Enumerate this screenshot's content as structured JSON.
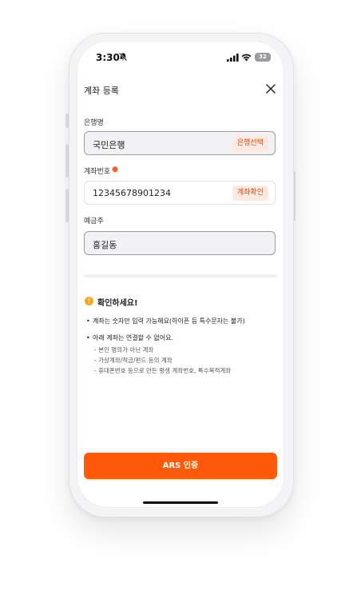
{
  "status_bar": {
    "time": "3:30",
    "battery": "32"
  },
  "header": {
    "title": "계좌 등록"
  },
  "bank": {
    "label": "은행명",
    "value": "국민은행",
    "action": "은행선택"
  },
  "account": {
    "label": "계좌번호",
    "value": "12345678901234",
    "action": "계좌확인"
  },
  "holder": {
    "label": "예금주",
    "value": "홍길동"
  },
  "notice": {
    "title": "확인하세요!",
    "bullets": [
      "계좌는 숫자만 입력 가능해요(하이픈 등 특수문자는 불가)",
      "아래 계좌는 연결할 수 없어요."
    ],
    "sub_items": [
      "- 본인 명의가 아닌 계좌",
      "- 가상계좌/적금/펀드 등의 계좌",
      "- 휴대폰번호 등으로 만든 평생 계좌번호, 특수목적계좌"
    ]
  },
  "cta": {
    "label": "ARS 인증"
  },
  "colors": {
    "accent": "#ff5a0a",
    "chip_bg": "#fde9e0",
    "chip_text": "#c84a14",
    "required": "#ff5a1f",
    "notice_icon": "#f5a623"
  }
}
